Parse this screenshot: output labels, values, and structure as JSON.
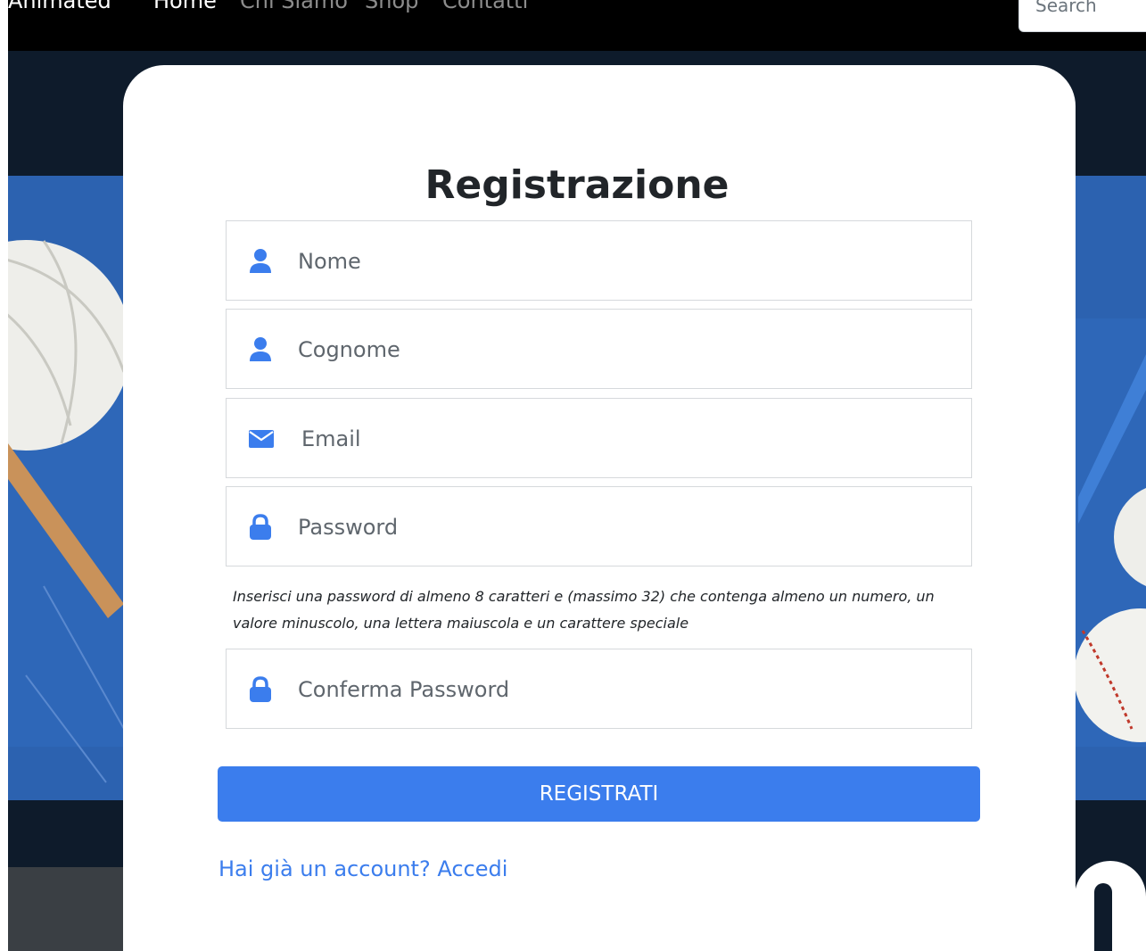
{
  "navbar": {
    "brand": "Animated",
    "links": [
      "Home",
      "Chi Siamo",
      "Shop",
      "Contatti"
    ],
    "search_placeholder": "Search"
  },
  "form": {
    "title": "Registrazione",
    "fields": {
      "nome_placeholder": "Nome",
      "cognome_placeholder": "Cognome",
      "email_placeholder": "Email",
      "password_placeholder": "Password",
      "conferma_placeholder": "Conferma Password"
    },
    "password_hint": "Inserisci una password di almeno 8 caratteri e (massimo 32) che contenga almeno un numero, un valore minuscolo, una lettera maiuscola e un carattere speciale",
    "submit_label": "REGISTRATI",
    "login_link": "Hai già un account? Accedi"
  },
  "colors": {
    "accent": "#3b7ded",
    "navbar_bg": "#000000",
    "page_bg": "#0e1b2b",
    "scene_blue": "#2c62b0"
  },
  "icons": [
    "user-icon",
    "user-icon",
    "envelope-icon",
    "lock-icon",
    "lock-icon"
  ]
}
